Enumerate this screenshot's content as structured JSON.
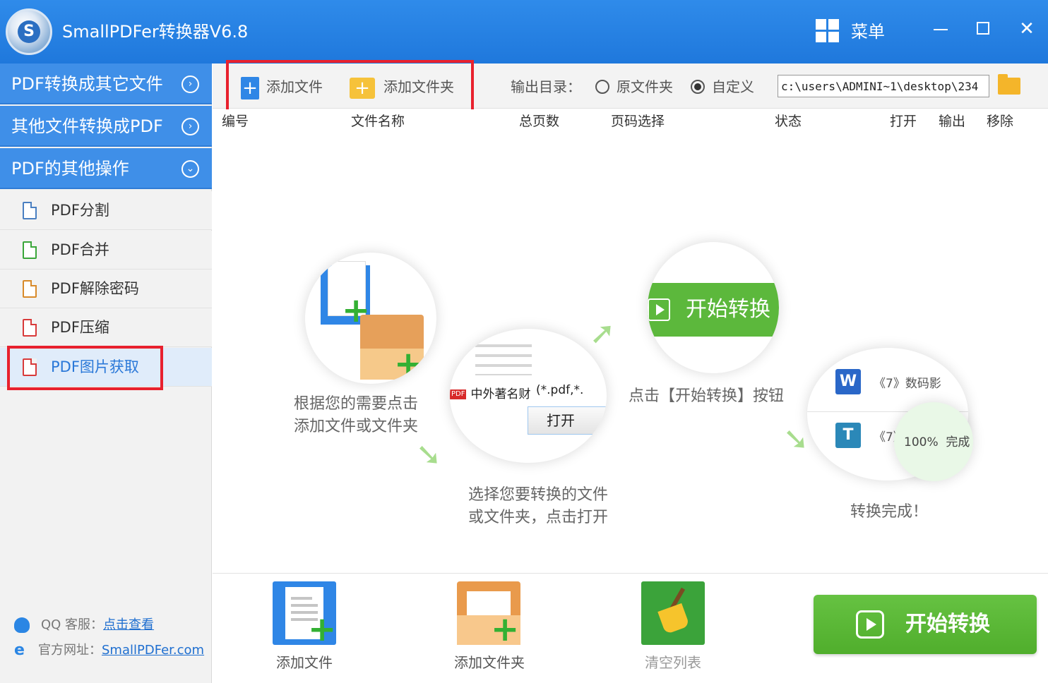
{
  "window": {
    "title": "SmallPDFer转换器V6.8",
    "logo_letter": "S",
    "menu_label": "菜单"
  },
  "sidebar": {
    "categories": [
      {
        "label": "PDF转换成其它文件",
        "state": "collapsed"
      },
      {
        "label": "其他文件转换成PDF",
        "state": "collapsed"
      },
      {
        "label": "PDF的其他操作",
        "state": "expanded"
      }
    ],
    "sub_items": [
      {
        "label": "PDF分割",
        "icon_color": "#4a7fc1"
      },
      {
        "label": "PDF合并",
        "icon_color": "#3aa63a"
      },
      {
        "label": "PDF解除密码",
        "icon_color": "#d88a2a"
      },
      {
        "label": "PDF压缩",
        "icon_color": "#d83a3a"
      },
      {
        "label": "PDF图片获取",
        "icon_color": "#d83a3a",
        "active": true
      }
    ],
    "support": {
      "qq_label": "QQ 客服：",
      "qq_link": "点击查看",
      "site_label": "官方网址：",
      "site_link": "SmallPDFer.com"
    }
  },
  "toolbar": {
    "add_file": "添加文件",
    "add_folder": "添加文件夹",
    "output_label": "输出目录：",
    "radio_original": "原文件夹",
    "radio_custom": "自定义",
    "selected_radio": "custom",
    "output_path": "c:\\users\\ADMINI~1\\desktop\\234"
  },
  "table_header": [
    "编号",
    "文件名称",
    "总页数",
    "页码选择",
    "状态",
    "打开",
    "输出",
    "移除"
  ],
  "steps": {
    "step1_line1": "根据您的需要点击",
    "step1_line2": "添加文件或文件夹",
    "step2_line1": "选择您要转换的文件",
    "step2_line2": "或文件夹，点击打开",
    "step3": "点击【开始转换】按钮",
    "step4": "转换完成！",
    "illus_start": "开始转换",
    "illus_file": "中外著名财",
    "illus_filter": "(*.pdf,*.",
    "illus_open": "打开",
    "illus_row1": "《7》数码影",
    "illus_row2": "《7》",
    "illus_w": "W",
    "illus_t": "T",
    "illus_done_pct": "100%",
    "illus_done": "完成"
  },
  "bottom": {
    "add_file": "添加文件",
    "add_folder": "添加文件夹",
    "clear_list": "清空列表",
    "start": "开始转换"
  },
  "colors": {
    "title_bar": "#2f8bea",
    "sidebar_category": "#3f8fe8",
    "start_green": "#5cb83c",
    "highlight_red": "#e8212e",
    "active_item_bg": "#e0ecfa"
  }
}
